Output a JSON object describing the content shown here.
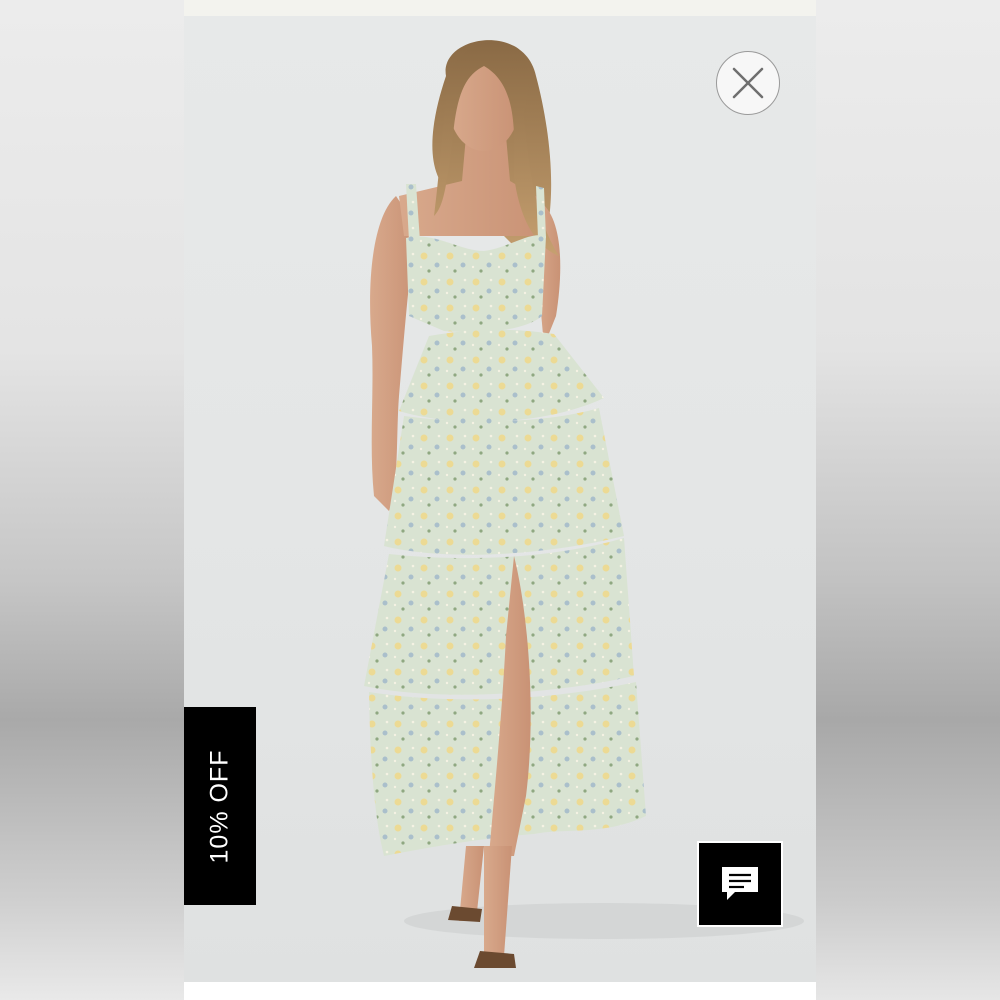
{
  "popup": {
    "close_icon": "close-icon",
    "discount_label": "10% OFF",
    "chat_icon": "chat-bubble-icon"
  },
  "colors": {
    "background_photo": "#e5e7e7",
    "discount_tab_bg": "#000000",
    "discount_tab_text": "#ffffff",
    "chat_button_bg": "#000000",
    "close_button_bg": "#f7f7f7"
  }
}
